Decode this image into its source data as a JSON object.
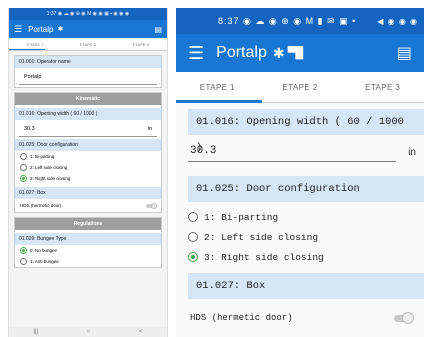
{
  "small_phone": {
    "status": "1:37 ◉ ☁ ◉ ⊕ ◉ M ◉ ◉ ▣ ▪ ◉ ◉ ◉",
    "app_title": "Portalp",
    "tabs": [
      "ETAPE 1",
      "ETAPE 2",
      "ETAPE 3"
    ],
    "operator_section": "01.001: Operator name",
    "operator_value": "Portalp",
    "kinematic_header": "Kinematic",
    "opening_width_label": "01.016: Opening width ( 60 / 1000 )",
    "opening_width_value": "30.3",
    "opening_width_unit": "in",
    "door_config_label": "01.025: Door configuration",
    "door_options": [
      "1: Bi-parting",
      "2: Left side closing",
      "3: Right side closing"
    ],
    "box_label": "01.027: Box",
    "hds_label": "HDS (hermetic door)",
    "regulations_header": "Regulations",
    "bungee_label": "01.029: Bungee Type",
    "bungee_options": [
      "0: No bungee",
      "1: Anti bungee"
    ],
    "nav": [
      "|||",
      "○",
      "<"
    ]
  },
  "large_phone": {
    "status_left": "8:37 ◉ ☁ ◉ ⊕ ◉ M ▮ ✉ ▣ •",
    "status_right": "◀ ◉ ◉ ◉",
    "app_title": "Portalp",
    "bt_icon": "✱",
    "extra_icon": "▀█",
    "tabs": [
      "ETAPE 1",
      "ETAPE 2",
      "ETAPE 3"
    ],
    "opening_width_label": "01.016: Opening width ( 60 / 1000 )",
    "opening_width_value": "30.3",
    "opening_width_unit": "in",
    "door_config_label": "01.025: Door configuration",
    "door_options": [
      "1: Bi-parting",
      "2: Left side closing",
      "3: Right side closing"
    ],
    "selected_door_option": 2,
    "box_label": "01.027: Box",
    "hds_label": "HDS (hermetic door)",
    "hds_enabled": false
  }
}
